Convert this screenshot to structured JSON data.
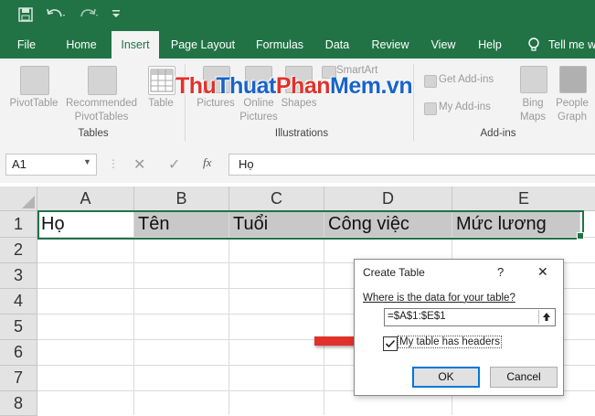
{
  "tabs": [
    "File",
    "Home",
    "Insert",
    "Page Layout",
    "Formulas",
    "Data",
    "Review",
    "View",
    "Help",
    "Tell me w"
  ],
  "active_tab": "Insert",
  "ribbon": {
    "pivottable": "PivotTable",
    "recommended_1": "Recommended",
    "recommended_2": "PivotTables",
    "table": "Table",
    "pictures": "Pictures",
    "online_1": "Online",
    "online_2": "Pictures",
    "shapes": "Shapes",
    "smartart": "SmartArt",
    "get_addins": "Get Add-ins",
    "my_addins": "My Add-ins",
    "bing_1": "Bing",
    "bing_2": "Maps",
    "people_1": "People",
    "people_2": "Graph",
    "group_tables": "Tables",
    "group_illustrations": "Illustrations",
    "group_addins": "Add-ins"
  },
  "watermark": {
    "part1": "Thu",
    "part2": "Thuat",
    "part3": "Phan",
    "part4": "Mem",
    "part5": ".vn"
  },
  "formula_bar": {
    "name_box": "A1",
    "fx": "fx",
    "content": "Họ"
  },
  "columns": [
    "A",
    "B",
    "C",
    "D",
    "E"
  ],
  "rows": [
    "1",
    "2",
    "3",
    "4",
    "5",
    "6",
    "7",
    "8"
  ],
  "row1": [
    "Họ",
    "Tên",
    "Tuổi",
    "Công việc",
    "Mức lương"
  ],
  "dialog": {
    "title": "Create Table",
    "help": "?",
    "close": "✕",
    "question": "Where is the data for your table?",
    "range": "=$A$1:$E$1",
    "checkbox_label": "My table has headers",
    "checked": true,
    "ok": "OK",
    "cancel": "Cancel"
  },
  "colors": {
    "excel_green": "#217346",
    "arrow_red": "#e0322b"
  }
}
